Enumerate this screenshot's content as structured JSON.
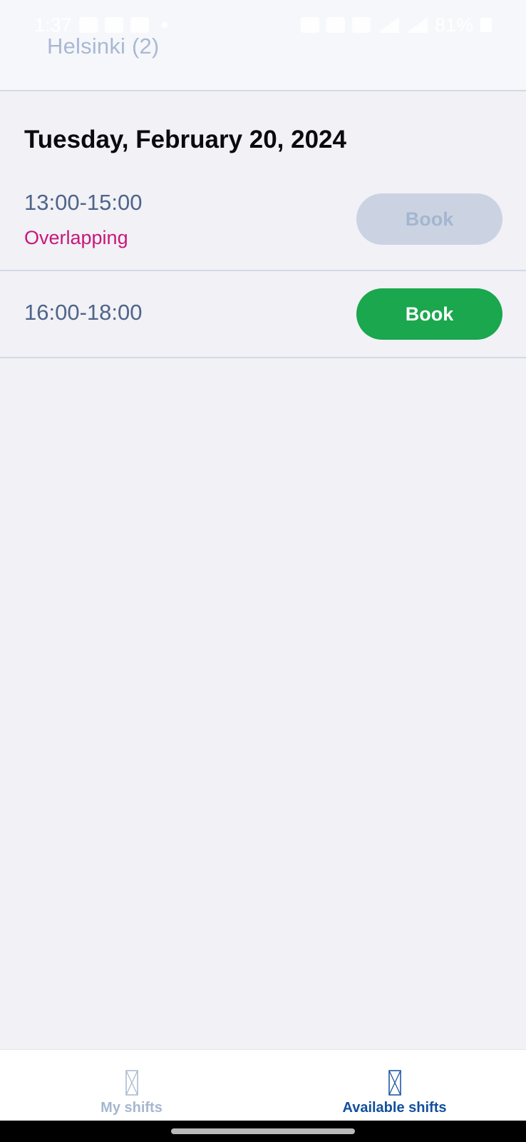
{
  "status_bar": {
    "time": "1:37",
    "battery": "81%"
  },
  "header": {
    "title": "Helsinki (2)"
  },
  "date_heading": "Tuesday, February 20, 2024",
  "shifts": [
    {
      "time": "13:00-15:00",
      "warning": "Overlapping",
      "button_label": "Book",
      "button_enabled": false
    },
    {
      "time": "16:00-18:00",
      "warning": "",
      "button_label": "Book",
      "button_enabled": true
    }
  ],
  "bottom_nav": {
    "items": [
      {
        "label": "My shifts",
        "icon": "my-shifts-icon",
        "active": false
      },
      {
        "label": "Available shifts",
        "icon": "available-shifts-icon",
        "active": true
      }
    ]
  },
  "colors": {
    "book_enabled": "#1aa74d",
    "book_disabled": "#cbd3e3",
    "warning": "#c8177a",
    "active_nav": "#134f9c",
    "inactive_nav": "#a6b7cf"
  }
}
